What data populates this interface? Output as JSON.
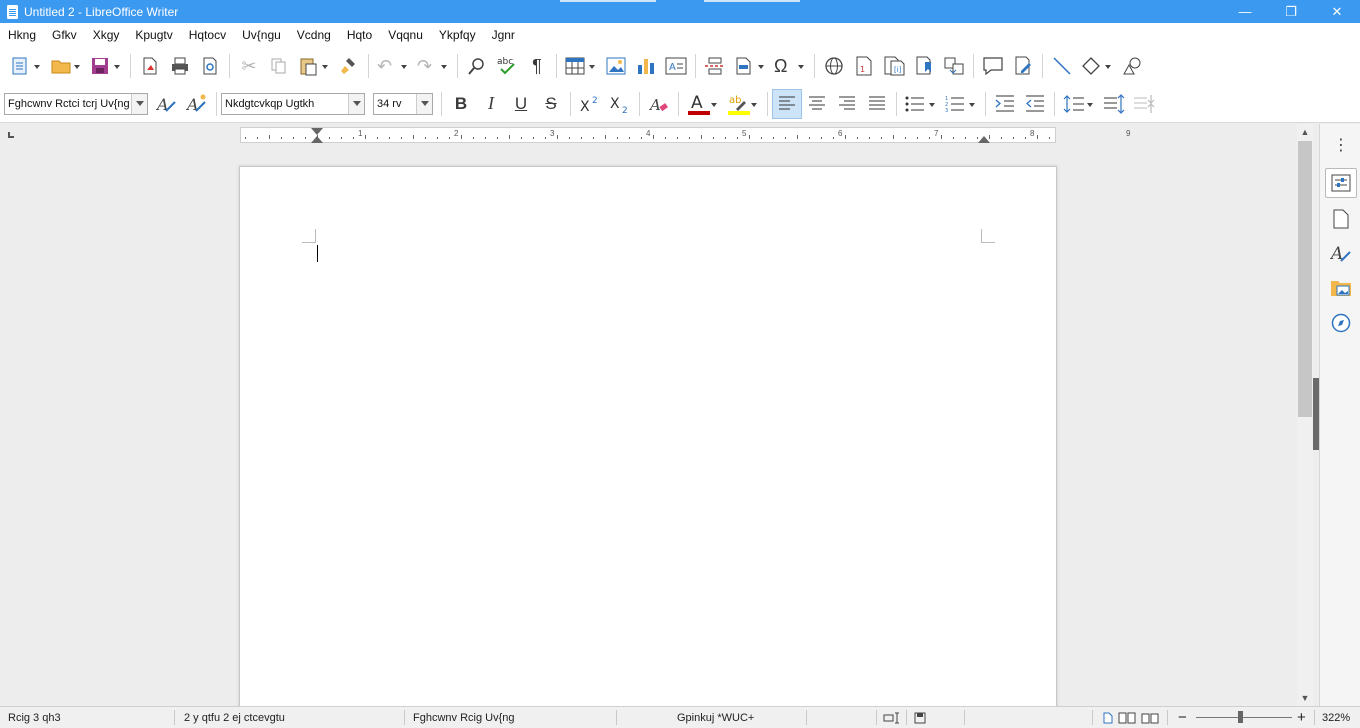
{
  "window": {
    "title": "Untitled 2 - LibreOffice Writer",
    "minimize_glyph": "—",
    "maximize_glyph": "❐",
    "close_glyph": "✕"
  },
  "menu": [
    "Hkng",
    "Gfkv",
    "Xkgy",
    "Kpugtv",
    "Hqtocv",
    "Uv{ngu",
    "Vcdng",
    "Hqto",
    "Vqqnu",
    "Ykpfqy",
    "Jgnr"
  ],
  "toolbar2": {
    "paragraph_style": "Fghcwnv Rctci tcrj Uv{ng",
    "font_name": "Nkdgtcvkqp Ugtkh",
    "font_size": "34 rv"
  },
  "ruler": {
    "numbers": [
      "1",
      "2",
      "3",
      "4",
      "5",
      "6",
      "7",
      "8",
      "9"
    ]
  },
  "statusbar": {
    "page": "Rcig 3 qh3",
    "words": "2 y qtfu 2 ej ctcevgtu",
    "page_style": "Fghcwnv Rcig Uv{ng",
    "language": "Gpinkuj *WUC+",
    "zoom": "322%"
  },
  "colors": {
    "titlebar": "#3c99f0",
    "font_color_bar": "#c00000",
    "highlight_bar": "#ffff00",
    "accent_active": "#cde3f7"
  },
  "icons": {
    "toolbar1": [
      "new-document-icon",
      "open-folder-icon",
      "save-icon",
      "export-pdf-icon",
      "print-icon",
      "print-preview-icon",
      "cut-icon",
      "copy-icon",
      "paste-icon",
      "clone-formatting-icon",
      "undo-icon",
      "redo-icon",
      "find-replace-icon",
      "spellcheck-icon",
      "formatting-marks-icon",
      "insert-table-icon",
      "insert-image-icon",
      "insert-chart-icon",
      "insert-textbox-icon",
      "page-break-icon",
      "insert-field-icon",
      "special-character-icon",
      "hyperlink-icon",
      "footnote-icon",
      "endnote-icon",
      "bookmark-icon",
      "cross-reference-icon",
      "comment-icon",
      "track-changes-icon",
      "line-icon",
      "basic-shapes-icon",
      "draw-shapes-icon"
    ],
    "sidebar": [
      "properties-icon",
      "page-icon",
      "styles-icon",
      "gallery-icon",
      "navigator-icon"
    ]
  }
}
